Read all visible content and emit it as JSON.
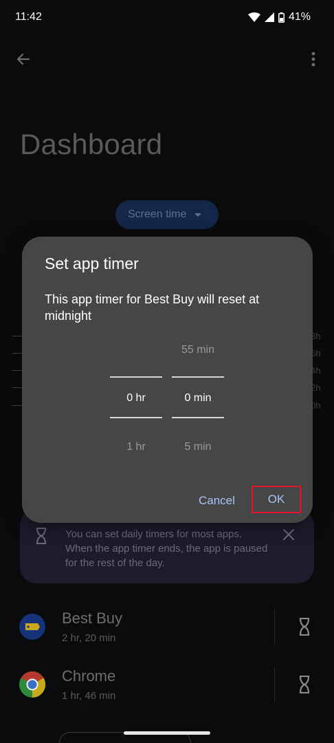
{
  "status_bar": {
    "time": "11:42",
    "battery": "41%"
  },
  "page": {
    "title": "Dashboard",
    "dropdown_label": "Screen time"
  },
  "chart_axis_labels": [
    "3h",
    "6h",
    "4h",
    "2h",
    "0h"
  ],
  "info_card": {
    "text": "You can set daily timers for most apps. When the app timer ends, the app is paused for the rest of the day."
  },
  "apps": [
    {
      "name": "Best Buy",
      "usage": "2 hr, 20 min",
      "icon": "best-buy-icon"
    },
    {
      "name": "Chrome",
      "usage": "1 hr, 46 min",
      "icon": "chrome-icon"
    }
  ],
  "dialog": {
    "title": "Set app timer",
    "message": "This app timer for Best Buy will reset at midnight",
    "hours": {
      "above": "",
      "selected": "0 hr",
      "below": "1 hr"
    },
    "minutes": {
      "above": "55 min",
      "selected": "0 min",
      "below": "5 min"
    },
    "cancel_label": "Cancel",
    "ok_label": "OK"
  },
  "colors": {
    "dialog_bg": "#464646",
    "accent": "#a8c5f7",
    "highlight_border": "#e5132a"
  }
}
